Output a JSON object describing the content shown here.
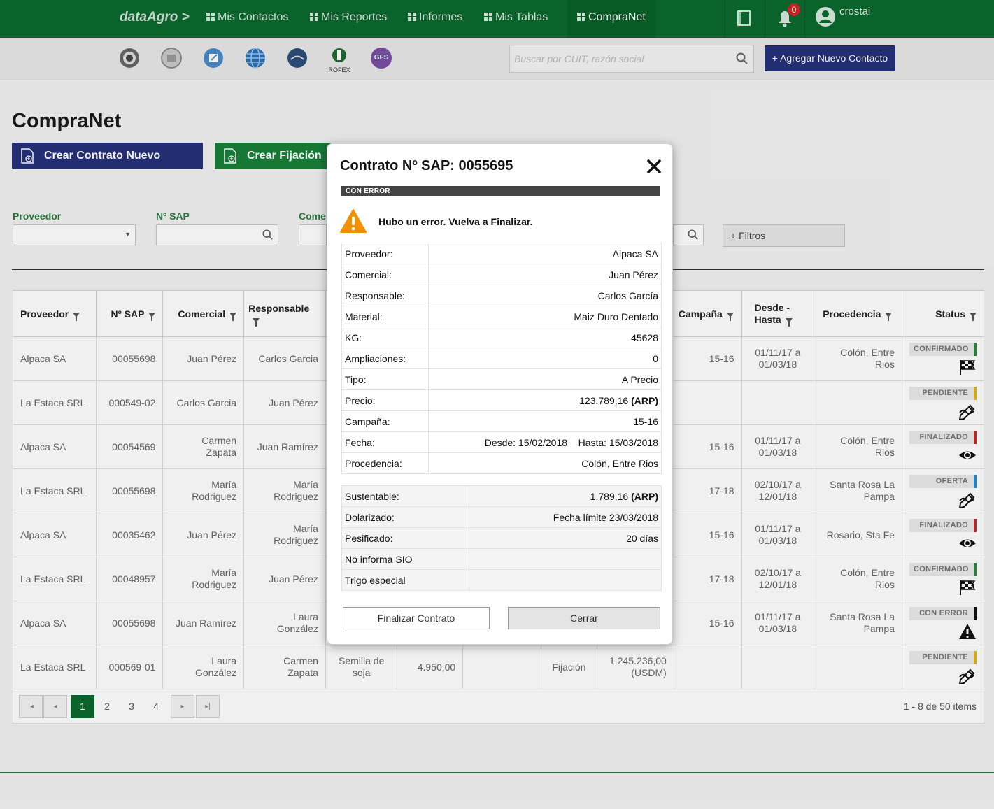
{
  "nav": {
    "brand": "dataAgro >",
    "items": [
      {
        "label": "Mis Contactos"
      },
      {
        "label": "Mis Reportes"
      },
      {
        "label": "Informes"
      },
      {
        "label": "Mis Tablas"
      },
      {
        "label": "CompraNet"
      }
    ],
    "notifications": "0",
    "user": "crostai"
  },
  "subbar": {
    "logos": [
      "logo-1",
      "logo-2",
      "edit-icon",
      "globe-icon",
      "logo-5",
      "ROFEX",
      "GFS"
    ],
    "rofex_label": "ROFEX",
    "gfs_label": "GFS",
    "search_placeholder": "Buscar por CUIT, razón social",
    "add_contact": "+ Agregar Nuevo Contacto"
  },
  "page": {
    "title": "CompraNet",
    "btn_new_contract": "Crear Contrato Nuevo",
    "btn_new_fixation": "Crear Fijación",
    "filters": {
      "proveedor": "Proveedor",
      "nsap": "Nº SAP",
      "comercial": "Come",
      "more": "+ Filtros"
    }
  },
  "table": {
    "headers": [
      "Proveedor",
      "Nº SAP",
      "Comercial",
      "Responsable",
      "Campaña",
      "Desde - Hasta",
      "Procedencia",
      "Status"
    ],
    "rows": [
      {
        "proveedor": "Alpaca SA",
        "sap": "00055698",
        "comercial": "Juan Pérez",
        "responsable": "Carlos Garcia",
        "extra1": "",
        "extra2": "",
        "extra3": "",
        "extra4": "",
        "extra5": "",
        "campana": "15-16",
        "fechas": "01/11/17 a 01/03/18",
        "procedencia": "Colón, Entre Rios",
        "status": "CONFIRMADO",
        "status_color": "#2a8a3e",
        "status_icon": "flag-icon"
      },
      {
        "proveedor": "La Estaca SRL",
        "sap": "000549-02",
        "comercial": "Carlos Garcia",
        "responsable": "Juan Pérez",
        "extra1": "",
        "extra2": "",
        "extra3": "",
        "extra4": "",
        "extra5": "",
        "campana": "",
        "fechas": "",
        "procedencia": "",
        "status": "PENDIENTE",
        "status_color": "#e3b21a",
        "status_icon": "sign-icon"
      },
      {
        "proveedor": "Alpaca SA",
        "sap": "00054569",
        "comercial": "Carmen Zapata",
        "responsable": "Juan Ramírez",
        "extra1": "",
        "extra2": "",
        "extra3": "",
        "extra4": "",
        "extra5": "",
        "campana": "15-16",
        "fechas": "01/11/17 a 01/03/18",
        "procedencia": "Colón, Entre Rios",
        "status": "FINALIZADO",
        "status_color": "#c62828",
        "status_icon": "eye-icon"
      },
      {
        "proveedor": "La Estaca SRL",
        "sap": "00055698",
        "comercial": "María Rodriguez",
        "responsable": "María Rodriguez",
        "extra1": "",
        "extra2": "",
        "extra3": "",
        "extra4": "",
        "extra5": "",
        "campana": "17-18",
        "fechas": "02/10/17 a 12/01/18",
        "procedencia": "Santa Rosa La Pampa",
        "status": "OFERTA",
        "status_color": "#1e88e5",
        "status_icon": "sign-icon"
      },
      {
        "proveedor": "Alpaca SA",
        "sap": "00035462",
        "comercial": "Juan Pérez",
        "responsable": "María Rodriguez",
        "extra1": "",
        "extra2": "",
        "extra3": "",
        "extra4": "",
        "extra5": "",
        "campana": "15-16",
        "fechas": "01/11/17 a 01/03/18",
        "procedencia": "Rosario, Sta Fe",
        "status": "FINALIZADO",
        "status_color": "#c62828",
        "status_icon": "eye-icon"
      },
      {
        "proveedor": "La Estaca SRL",
        "sap": "00048957",
        "comercial": "María Rodriguez",
        "responsable": "Juan Pérez",
        "extra1": "",
        "extra2": "",
        "extra3": "",
        "extra4": "",
        "extra5": "",
        "campana": "17-18",
        "fechas": "02/10/17 a 12/01/18",
        "procedencia": "Colón, Entre Rios",
        "status": "CONFIRMADO",
        "status_color": "#2a8a3e",
        "status_icon": "flag-icon"
      },
      {
        "proveedor": "Alpaca SA",
        "sap": "00055698",
        "comercial": "Juan Ramírez",
        "responsable": "Laura González",
        "extra1": "",
        "extra2": "",
        "extra3": "",
        "extra4": "",
        "extra5": "",
        "campana": "15-16",
        "fechas": "01/11/17 a 01/03/18",
        "procedencia": "Santa Rosa La Pampa",
        "status": "CON ERROR",
        "status_color": "#111111",
        "status_icon": "warning-icon"
      },
      {
        "proveedor": "La Estaca SRL",
        "sap": "000569-01",
        "comercial": "Laura González",
        "responsable": "Carmen Zapata",
        "extra1": "Semilla de soja",
        "extra2": "4.950,00",
        "extra3": "",
        "extra4": "Fijación",
        "extra5": "1.245.236,00 (USDM)",
        "campana": "",
        "fechas": "",
        "procedencia": "",
        "status": "PENDIENTE",
        "status_color": "#e3b21a",
        "status_icon": "sign-icon"
      }
    ]
  },
  "pager": {
    "pages": [
      "1",
      "2",
      "3",
      "4"
    ],
    "current": "1",
    "info": "1 - 8 de 50 items"
  },
  "modal": {
    "title": "Contrato Nº SAP: 0055695",
    "status_bar": "CON ERROR",
    "message": "Hubo un error. Vuelva a Finalizar.",
    "details": [
      {
        "label": "Proveedor:",
        "value": "Alpaca SA"
      },
      {
        "label": "Comercial:",
        "value": "Juan Pérez"
      },
      {
        "label": "Responsable:",
        "value": "Carlos García"
      },
      {
        "label": "Material:",
        "value": "Maiz Duro Dentado"
      },
      {
        "label": "KG:",
        "value": "45628"
      },
      {
        "label": "Ampliaciones:",
        "value": "0"
      },
      {
        "label": "Tipo:",
        "value": "A Precio"
      },
      {
        "label": "Precio:",
        "value": "123.789,16",
        "suffix": "(ARP)"
      },
      {
        "label": "Campaña:",
        "value": "15-16"
      },
      {
        "label": "Fecha:",
        "value": "Desde: 15/02/2018    Hasta: 15/03/2018"
      },
      {
        "label": "Procedencia:",
        "value": "Colón, Entre Rios"
      }
    ],
    "extras": [
      {
        "label": "Sustentable:",
        "value": "1.789,16",
        "suffix": "(ARP)"
      },
      {
        "label": "Dolarizado:",
        "value": "Fecha límite 23/03/2018"
      },
      {
        "label": "Pesificado:",
        "value": "20 días"
      },
      {
        "label": "No informa SIO",
        "value": ""
      },
      {
        "label": "Trigo especial",
        "value": ""
      }
    ],
    "btn_finalize": "Finalizar Contrato",
    "btn_close": "Cerrar"
  }
}
